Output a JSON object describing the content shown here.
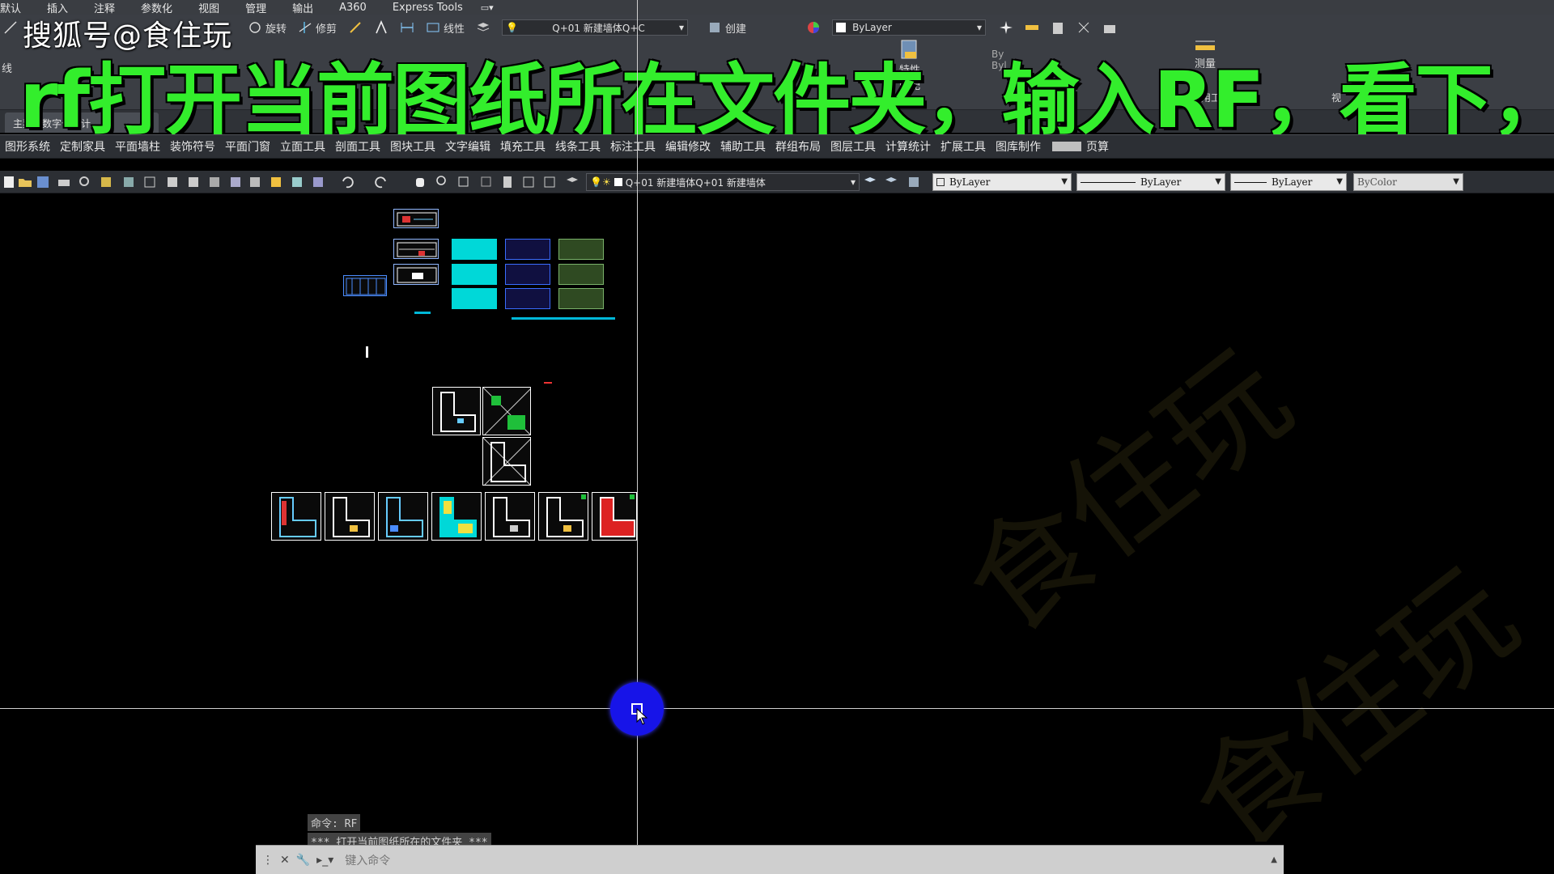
{
  "menubar": {
    "items": [
      "默认",
      "插入",
      "注释",
      "参数化",
      "视图",
      "管理",
      "输出",
      "A360",
      "Express Tools"
    ],
    "extra": "▭▾"
  },
  "ribbon": {
    "row1": {
      "line_label": "直线",
      "rotate": "旋转",
      "trim": "修剪",
      "linear": "线性",
      "layer_combo": "Q+01 新建墙体Q+C",
      "create": "创建",
      "bylayer": "ByLayer"
    },
    "row2": {
      "line_short": "线",
      "props": "特性",
      "match": "匹配",
      "measure": "测量",
      "by_small": "By",
      "byl_small": "Byl",
      "util": "实用工具",
      "view": "视"
    }
  },
  "overlay": {
    "source": "搜狐号@食住玩",
    "caption": "rf打开当前图纸所在文件夹，输入RF，看下，"
  },
  "file_tab": {
    "label": "主菜单数字化设计",
    "add": "+"
  },
  "tangent_menu": {
    "items": [
      "图形系统",
      "定制家具",
      "平面墙柱",
      "装饰符号",
      "平面门窗",
      "立面工具",
      "剖面工具",
      "图块工具",
      "文字编辑",
      "填充工具",
      "线条工具",
      "标注工具",
      "编辑修改",
      "辅助工具",
      "群组布局",
      "图层工具",
      "计算统计",
      "扩展工具",
      "图库制作"
    ],
    "tail": "页算"
  },
  "std_toolbar": {
    "layer_text": "Q+01 新建墙体Q+01 新建墙体",
    "color": "ByLayer",
    "linetype": "ByLayer",
    "lineweight": "ByLayer",
    "plotstyle": "ByColor"
  },
  "command": {
    "history": [
      "命令: RF",
      "*** 打开当前图纸所在的文件夹 ***"
    ],
    "placeholder": "键入命令"
  },
  "watermark": "食住玩",
  "colors": {
    "caption_green": "#33ee2c",
    "canvas_bg": "#000000",
    "cursor_blue": "#1714e8",
    "sheet_cyan": "#00e5e5"
  }
}
